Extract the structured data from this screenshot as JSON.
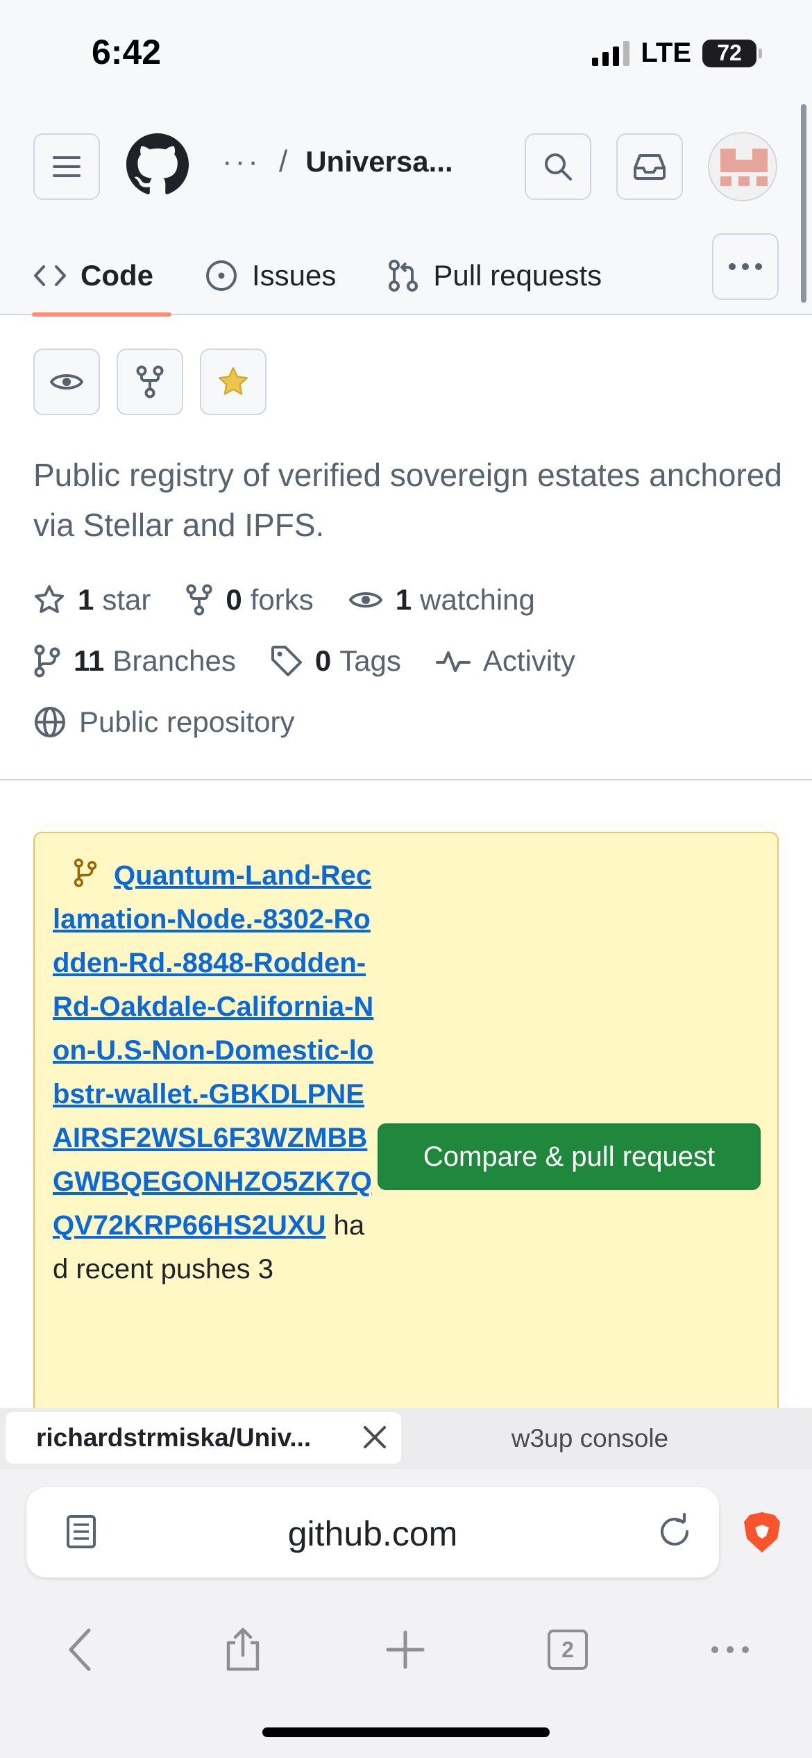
{
  "status_bar": {
    "time": "6:42",
    "network": "LTE",
    "battery": "72"
  },
  "header": {
    "breadcrumb_dots": "···",
    "breadcrumb_sep": "/",
    "repo_name": "Universa...",
    "tabs": [
      {
        "label": "Code",
        "icon": "code-icon",
        "active": true
      },
      {
        "label": "Issues",
        "icon": "issue-icon"
      },
      {
        "label": "Pull requests",
        "icon": "pull-request-icon"
      }
    ],
    "more_icon": "kebab-horizontal-icon"
  },
  "repo": {
    "description": "Public registry of verified sovereign estates anchored via Stellar and IPFS.",
    "stats": {
      "stars_count": "1",
      "stars_label": "star",
      "forks_count": "0",
      "forks_label": "forks",
      "watching_count": "1",
      "watching_label": "watching",
      "branches_count": "11",
      "branches_label": "Branches",
      "tags_count": "0",
      "tags_label": "Tags",
      "activity_label": "Activity",
      "visibility_label": "Public repository"
    }
  },
  "banner": {
    "branch_name": "Quantum-Land-Reclamation-Node.-8302-Rodden-Rd.-8848-Rodden-Rd-Oakdale-California-Non-U.S-Non-Domestic-lobstr-wallet.-GBKDLPNEAIRSF2WSL6F3WZMBBGWBQEGONHZO5ZK7QQV72KRP66HS2UXU",
    "suffix": " had recent pushes 3",
    "button_label": "Compare & pull request"
  },
  "browser": {
    "active_tab": "richardstrmiska/Univ...",
    "inactive_tab": "w3up console",
    "url": "github.com",
    "tab_count": "2"
  },
  "colors": {
    "tab_underline": "#fd8c73",
    "star_fill": "#eac54f",
    "link": "#0969da",
    "primary_button": "#1f883d",
    "banner_bg": "#fff8c5",
    "brave": "#fb542b"
  }
}
